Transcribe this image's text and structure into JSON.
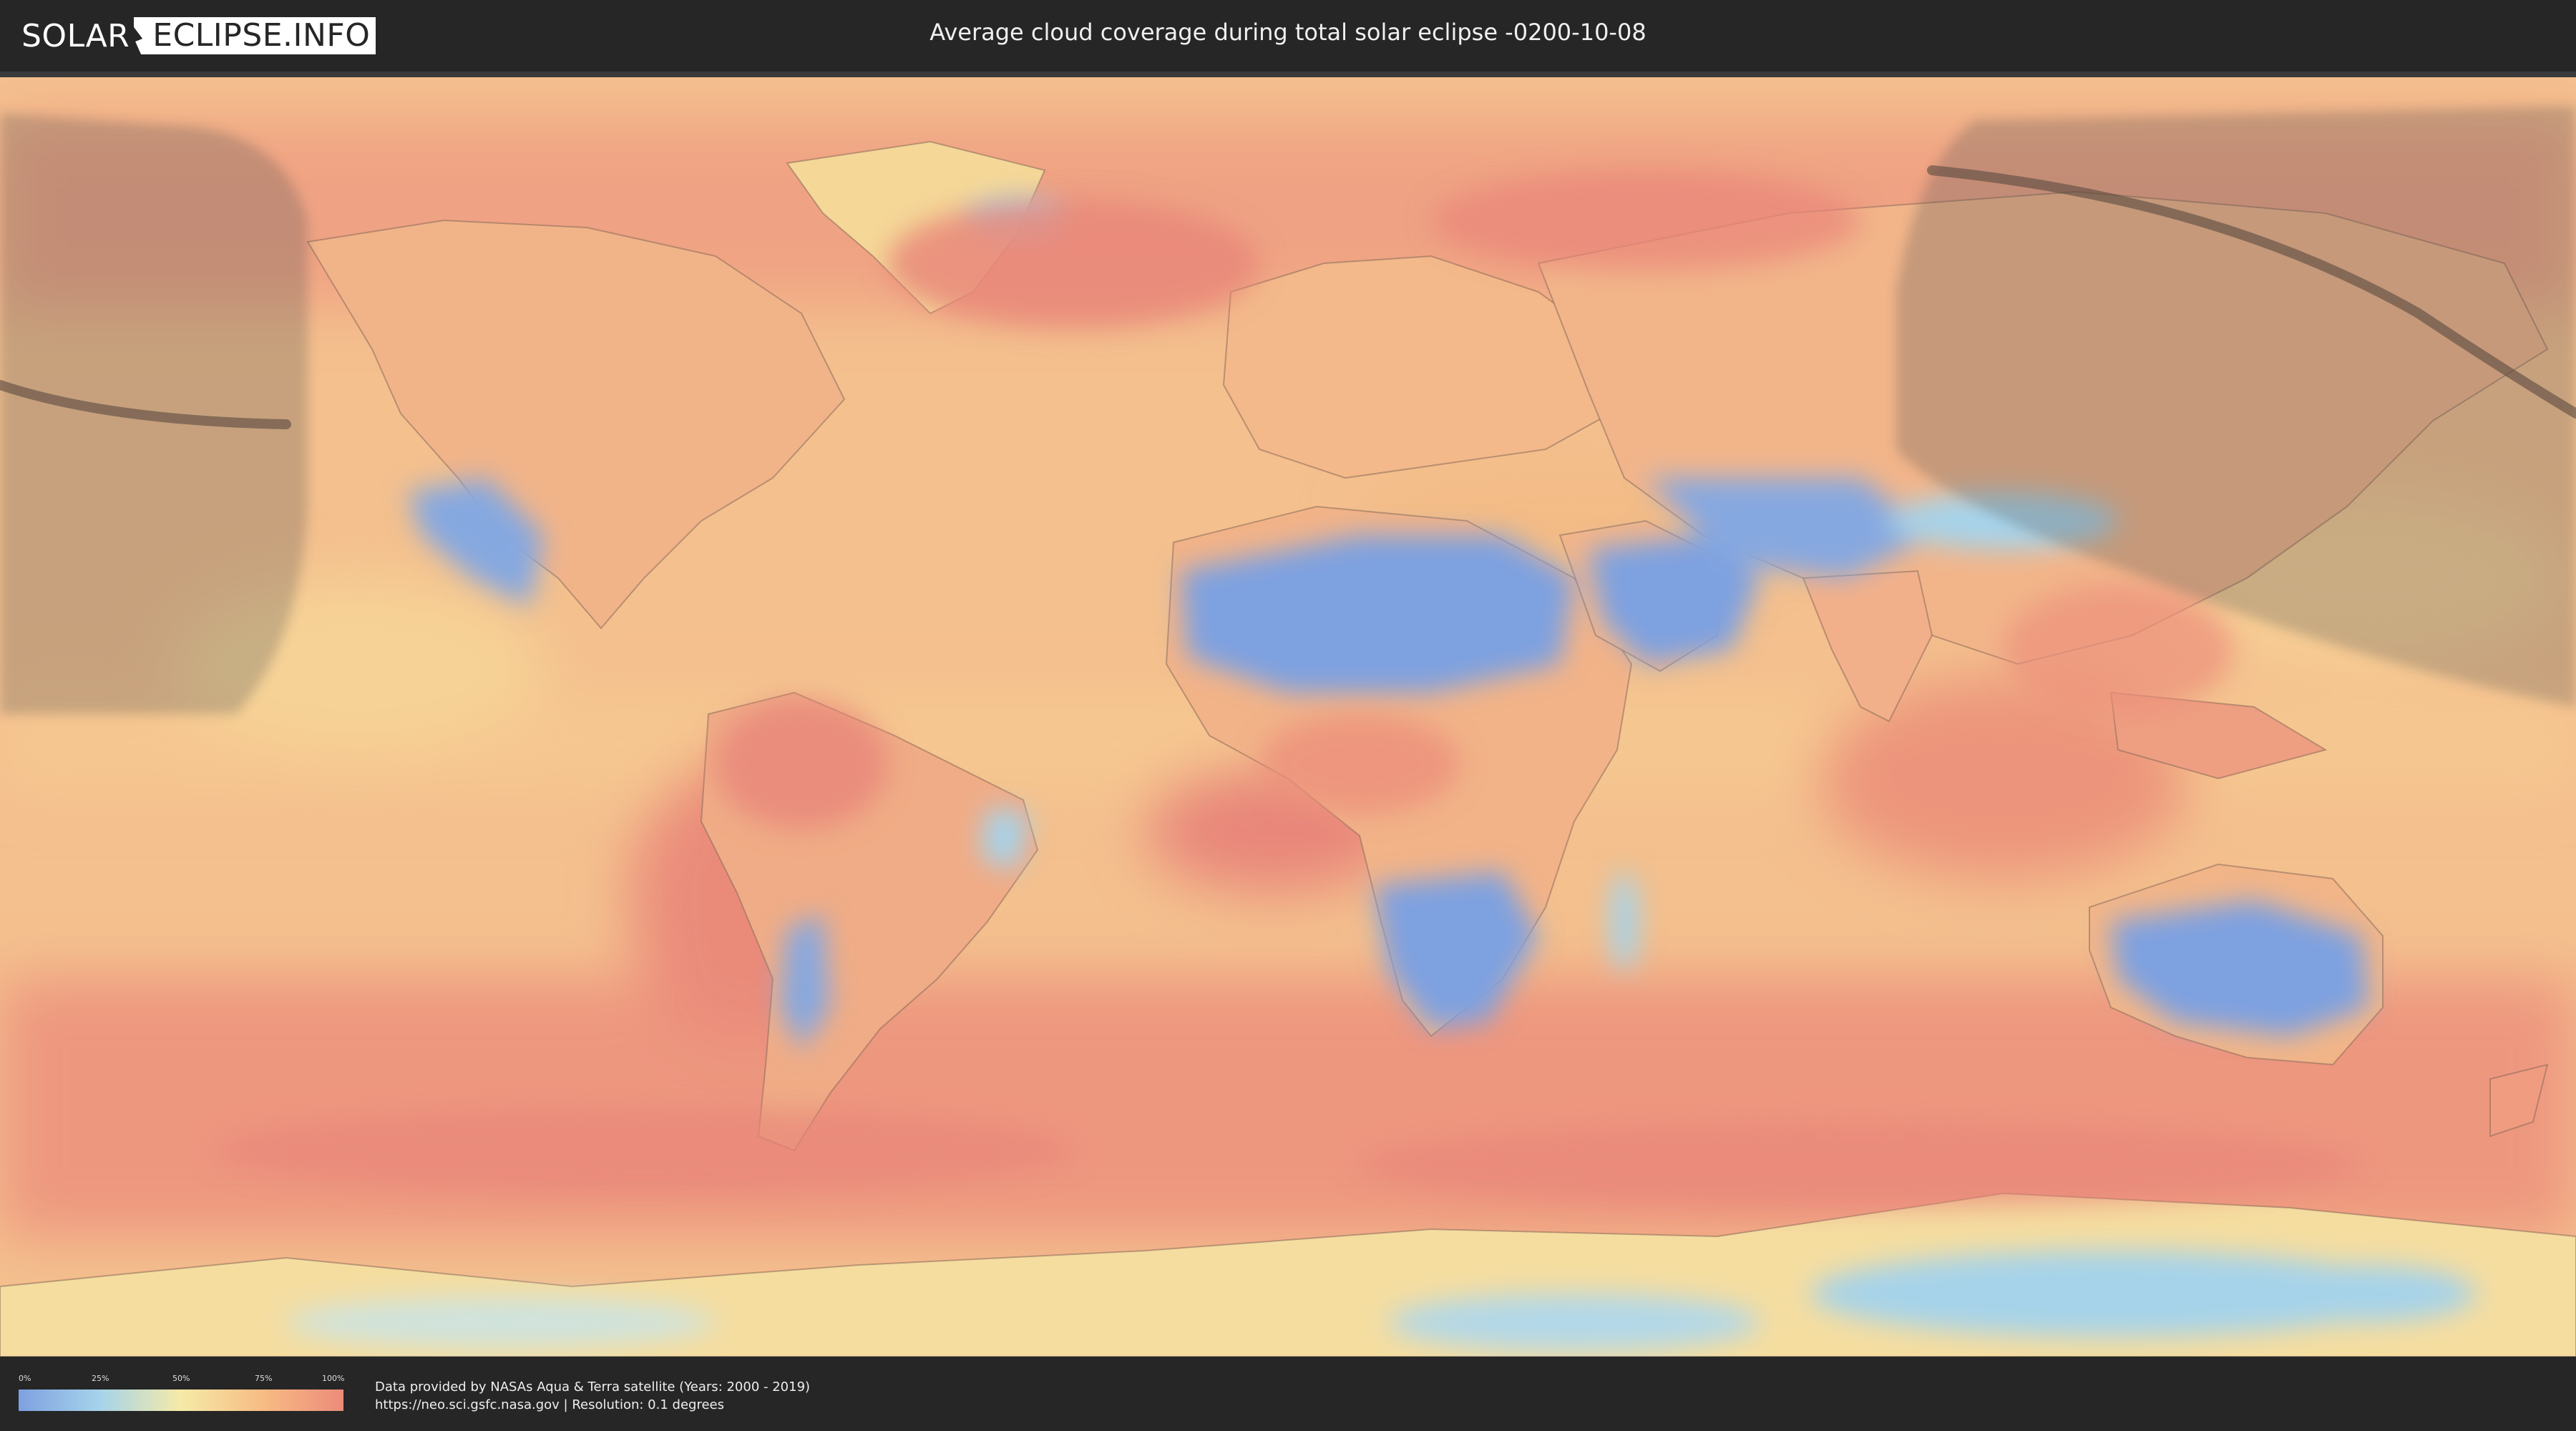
{
  "header": {
    "logo_part1": "SOLAR",
    "logo_part2": "ECLIPSE.INFO",
    "title": "Average cloud coverage during total solar eclipse -0200-10-08"
  },
  "legend": {
    "ticks": [
      "0%",
      "25%",
      "50%",
      "75%",
      "100%"
    ],
    "colors": [
      "#7ea1e0",
      "#a6d3ea",
      "#f5eaa7",
      "#f7bc84",
      "#ec8b7a"
    ]
  },
  "footer": {
    "credit_line1": "Data provided by NASAs Aqua & Terra satellite (Years: 2000 - 2019)",
    "credit_line2": "https://neo.sci.gsfc.nasa.gov | Resolution: 0.1 degrees"
  },
  "map": {
    "palette": {
      "clear": "#7ea1e0",
      "light": "#a6d3ea",
      "medium": "#f5d99a",
      "cloudy": "#f3a582",
      "overcast": "#ea8a7a",
      "shadow": "#555555",
      "path": "#5a4a40"
    }
  }
}
